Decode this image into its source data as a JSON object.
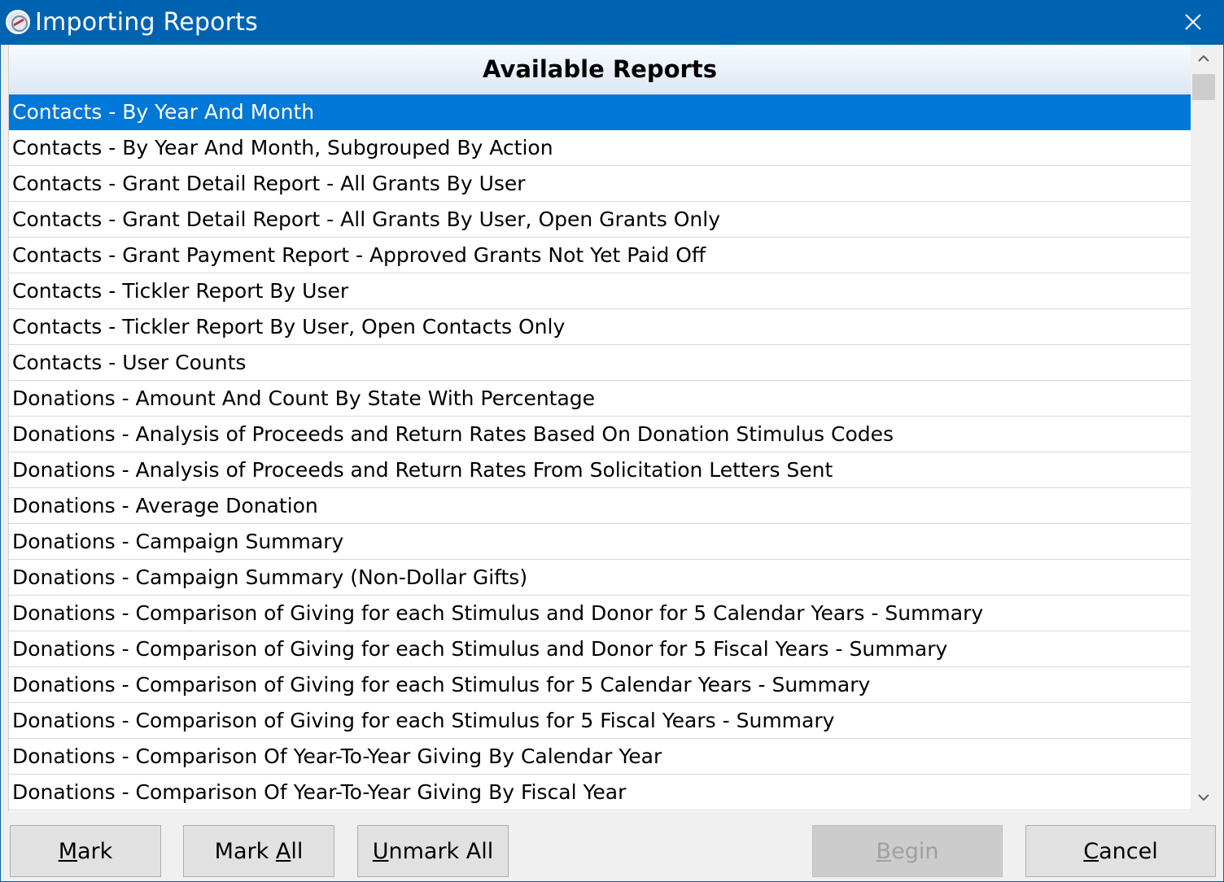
{
  "window": {
    "title": "Importing Reports"
  },
  "list": {
    "header": "Available Reports",
    "selected_index": 0,
    "items": [
      "Contacts - By Year And Month",
      "Contacts - By Year And Month, Subgrouped By Action",
      "Contacts - Grant Detail Report - All Grants By User",
      "Contacts - Grant Detail Report - All Grants By User, Open Grants Only",
      "Contacts - Grant Payment Report - Approved Grants Not Yet Paid Off",
      "Contacts - Tickler Report By User",
      "Contacts - Tickler Report By User, Open Contacts Only",
      "Contacts - User Counts",
      "Donations - Amount And Count By State With Percentage",
      "Donations - Analysis of Proceeds and Return Rates Based On Donation Stimulus Codes",
      "Donations - Analysis of Proceeds and Return Rates From Solicitation Letters Sent",
      "Donations - Average Donation",
      "Donations - Campaign Summary",
      "Donations - Campaign Summary (Non-Dollar Gifts)",
      "Donations - Comparison of Giving for each Stimulus and Donor for 5 Calendar Years - Summary",
      "Donations - Comparison of Giving for each Stimulus and Donor for 5 Fiscal Years - Summary",
      "Donations - Comparison of Giving for each Stimulus for 5 Calendar Years - Summary",
      "Donations - Comparison of Giving for each Stimulus for 5 Fiscal Years - Summary",
      "Donations - Comparison Of Year-To-Year Giving By Calendar Year",
      "Donations - Comparison Of Year-To-Year Giving By Fiscal Year"
    ]
  },
  "buttons": {
    "mark": {
      "mnemonic": "M",
      "rest": "ark"
    },
    "mark_all": {
      "pre": "Mark ",
      "mnemonic": "A",
      "rest": "ll"
    },
    "unmark_all": {
      "mnemonic": "U",
      "rest": "nmark All"
    },
    "begin": {
      "mnemonic": "B",
      "rest": "egin",
      "disabled": true
    },
    "cancel": {
      "mnemonic": "C",
      "rest": "ancel"
    }
  },
  "colors": {
    "titlebar": "#0063b1",
    "selection": "#0078d7"
  },
  "icons": {
    "app": "compass-icon",
    "close": "close-icon",
    "scroll_up": "chevron-up-icon",
    "scroll_down": "chevron-down-icon"
  }
}
